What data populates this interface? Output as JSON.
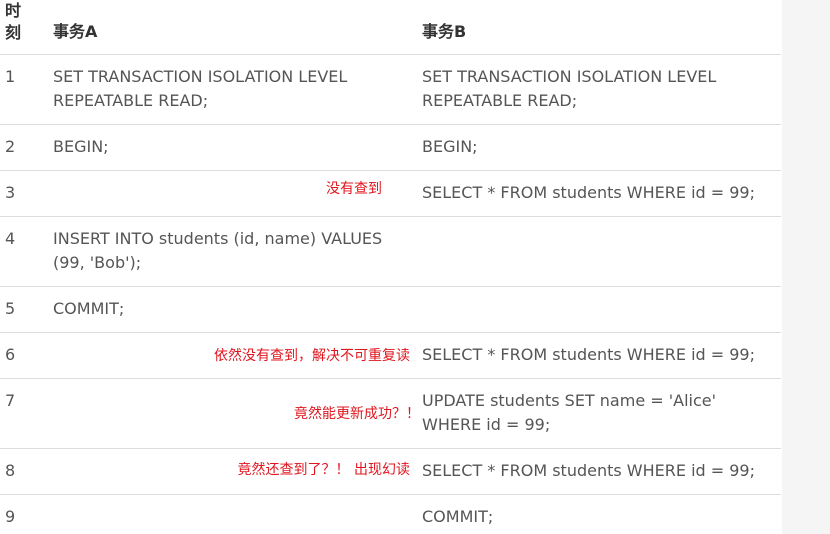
{
  "table": {
    "headers": {
      "time": "时\n刻",
      "txA": "事务A",
      "txB": "事务B"
    },
    "rows": [
      {
        "time": "1",
        "a": "SET TRANSACTION ISOLATION LEVEL REPEATABLE READ;",
        "b": "SET TRANSACTION ISOLATION LEVEL REPEATABLE READ;",
        "note": ""
      },
      {
        "time": "2",
        "a": "BEGIN;",
        "b": "BEGIN;",
        "note": ""
      },
      {
        "time": "3",
        "a": "",
        "b": "SELECT * FROM students WHERE id = 99;",
        "note": "没有查到"
      },
      {
        "time": "4",
        "a": "INSERT INTO students (id, name) VALUES (99, 'Bob');",
        "b": "",
        "note": ""
      },
      {
        "time": "5",
        "a": "COMMIT;",
        "b": "",
        "note": ""
      },
      {
        "time": "6",
        "a": "",
        "b": "SELECT * FROM students WHERE id = 99;",
        "note": "依然没有查到，解决不可重复读"
      },
      {
        "time": "7",
        "a": "",
        "b": "UPDATE students SET name = 'Alice' WHERE id = 99;",
        "note": "竟然能更新成功？！"
      },
      {
        "time": "8",
        "a": "",
        "b": "SELECT * FROM students WHERE id = 99;",
        "note": "竟然还查到了？！ 出现幻读"
      },
      {
        "time": "9",
        "a": "",
        "b": "COMMIT;",
        "note": ""
      }
    ]
  },
  "colors": {
    "note": "#e0161f",
    "text": "#555555",
    "header": "#333333",
    "border": "#dddddd"
  }
}
